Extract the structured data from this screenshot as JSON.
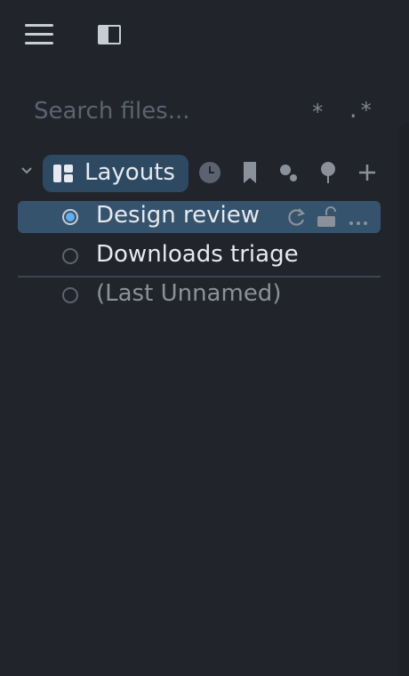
{
  "toolbar": {
    "menu_icon": "hamburger-menu-icon",
    "panel_icon": "sidebar-panel-icon"
  },
  "search": {
    "placeholder": "Search files...",
    "value": "",
    "glob_toggle": "*",
    "regex_toggle": ".*"
  },
  "group": {
    "label": "Layouts",
    "expanded": true,
    "icon": "layouts-grid-icon",
    "tools": [
      "clock-icon",
      "bookmark-icon",
      "dots-cluster-icon",
      "pin-icon",
      "add-icon"
    ]
  },
  "layouts": [
    {
      "label": "Design review",
      "selected": true,
      "dim": false,
      "actions": [
        "refresh-icon",
        "lock-icon",
        "more-icon"
      ]
    },
    {
      "label": "Downloads triage",
      "selected": false,
      "dim": false
    },
    {
      "label": "(Last Unnamed)",
      "selected": false,
      "dim": true
    }
  ],
  "colors": {
    "background": "#21252b",
    "selection": "#36536d",
    "pill": "#2e4a62",
    "accent": "#61afef"
  }
}
